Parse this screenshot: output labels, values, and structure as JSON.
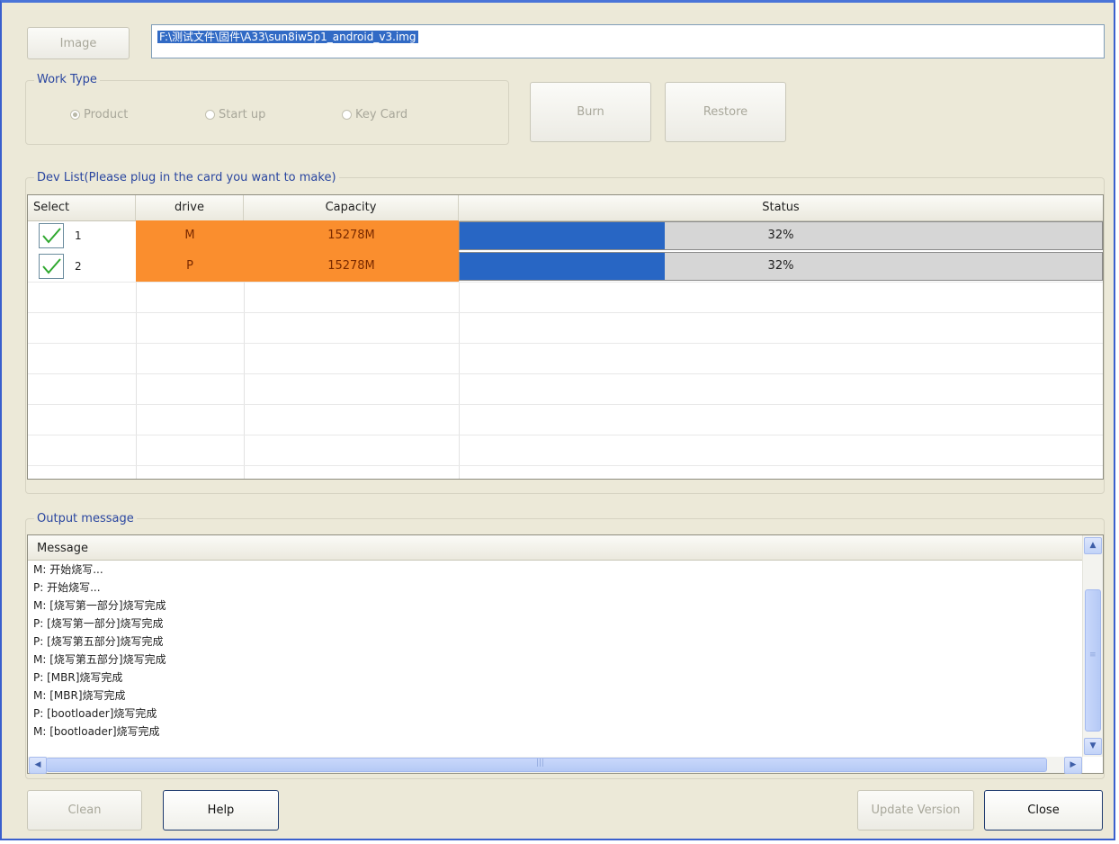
{
  "toolbar": {
    "image_button": "Image",
    "image_path": "F:\\测试文件\\固件\\A33\\sun8iw5p1_android_v3.img"
  },
  "work_type": {
    "legend": "Work Type",
    "options": [
      {
        "label": "Product",
        "selected": true
      },
      {
        "label": "Start up",
        "selected": false
      },
      {
        "label": "Key Card",
        "selected": false
      }
    ]
  },
  "actions": {
    "burn": "Burn",
    "restore": "Restore"
  },
  "dev_list": {
    "legend": "Dev List(Please plug in the card you want to make)",
    "columns": [
      "Select",
      "drive",
      "Capacity",
      "Status"
    ],
    "rows": [
      {
        "index": "1",
        "checked": true,
        "drive": "M",
        "capacity": "15278M",
        "progress": 0.32,
        "status": "32%"
      },
      {
        "index": "2",
        "checked": true,
        "drive": "P",
        "capacity": "15278M",
        "progress": 0.32,
        "status": "32%"
      }
    ]
  },
  "output": {
    "legend": "Output message",
    "header": "Message",
    "lines": [
      "M: 开始烧写...",
      "P: 开始烧写...",
      "M: [烧写第一部分]烧写完成",
      "P: [烧写第一部分]烧写完成",
      "P: [烧写第五部分]烧写完成",
      "M: [烧写第五部分]烧写完成",
      "P: [MBR]烧写完成",
      "M: [MBR]烧写完成",
      "P: [bootloader]烧写完成",
      "M: [bootloader]烧写完成"
    ]
  },
  "footer": {
    "clean": "Clean",
    "help": "Help",
    "update_version": "Update Version",
    "close": "Close"
  },
  "colors": {
    "window_bg": "#ece9d8",
    "orange_cell": "#fa8e2e",
    "progress_fill": "#2866c4",
    "selection": "#316ac5",
    "check": "#2fa82f"
  }
}
